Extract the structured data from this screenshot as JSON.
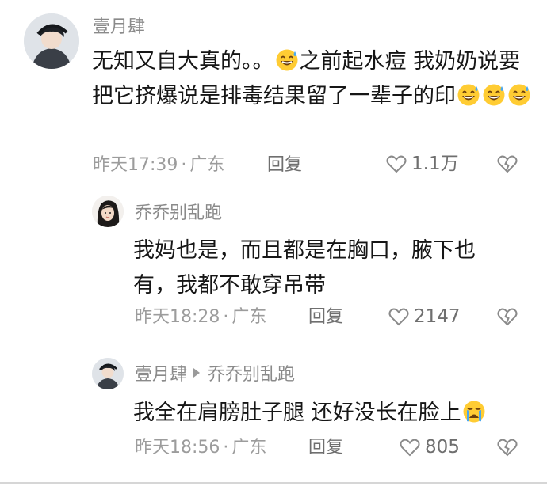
{
  "comments": [
    {
      "username": "壹月肆",
      "text_parts": [
        "无知又自大真的。。",
        "之前起水痘 我奶奶说要把它挤爆说是排毒结果留了一辈子的印"
      ],
      "time": "昨天17:39",
      "location": "广东",
      "reply_label": "回复",
      "likes": "1.1万",
      "emoji_after_first": "grinning-sweat",
      "trailing_emojis": [
        "grinning-sweat",
        "grinning-sweat",
        "grinning-sweat"
      ]
    },
    {
      "username": "乔乔别乱跑",
      "text": "我妈也是，而且都是在胸口，腋下也有，我都不敢穿吊带",
      "time": "昨天18:28",
      "location": "广东",
      "reply_label": "回复",
      "likes": "2147"
    },
    {
      "username": "壹月肆",
      "reply_to": "乔乔别乱跑",
      "text": "我全在肩膀肚子腿 还好没长在脸上",
      "time": "昨天18:56",
      "location": "广东",
      "reply_label": "回复",
      "likes": "805",
      "trailing_emoji": "crying-face"
    }
  ],
  "icons": {
    "like": "heart-outline-icon",
    "dislike": "broken-heart-icon",
    "reply_arrow": "triangle-right-icon"
  },
  "colors": {
    "username": "#8a8a8a",
    "body_text": "#161616",
    "meta_text": "#9c9c9c",
    "action_text": "#6f6f6f",
    "emoji_face": "#ffcc33",
    "emoji_tear": "#4aa8f0"
  }
}
